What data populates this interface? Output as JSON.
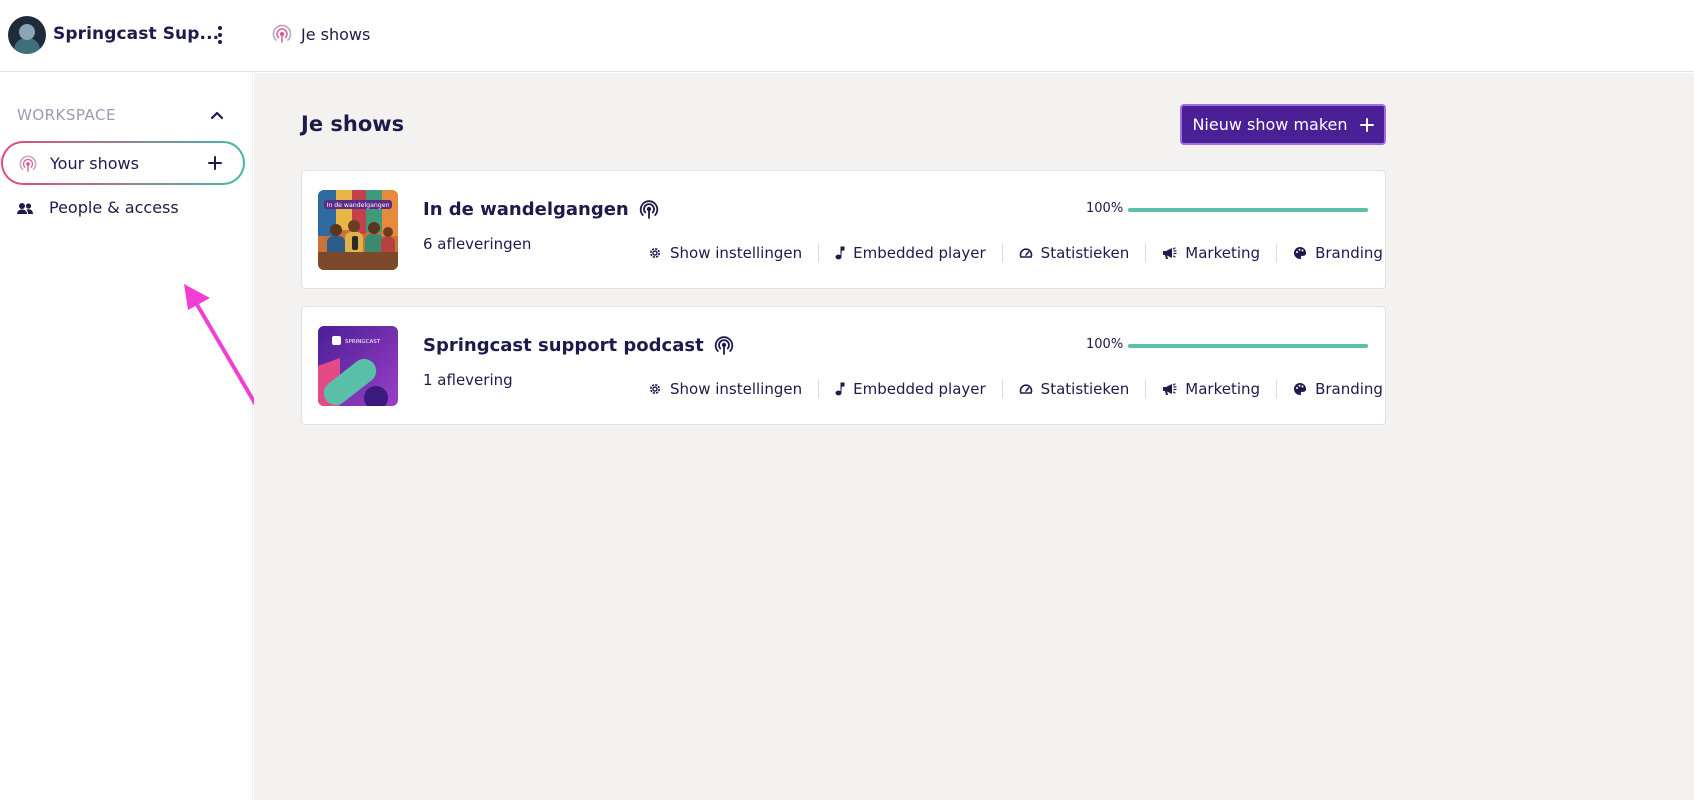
{
  "topbar": {
    "workspace_name": "Springcast Sup...",
    "breadcrumb": "Je shows"
  },
  "sidebar": {
    "section_label": "WORKSPACE",
    "items": [
      {
        "label": "Your shows",
        "icon": "podcast-icon"
      },
      {
        "label": "People & access",
        "icon": "people-icon"
      }
    ]
  },
  "main": {
    "title": "Je shows",
    "new_show_label": "Nieuw show maken",
    "shows": [
      {
        "title": "In de wandelgangen",
        "episodes": "6 afleveringen",
        "progress_label": "100%",
        "progress": 1.0,
        "cover_caption": "In de wandelgangen",
        "actions": [
          "Show instellingen",
          "Embedded player",
          "Statistieken",
          "Marketing",
          "Branding"
        ]
      },
      {
        "title": "Springcast support podcast",
        "episodes": "1 aflevering",
        "progress_label": "100%",
        "progress": 1.0,
        "cover_caption": "SPRINGCAST",
        "actions": [
          "Show instellingen",
          "Embedded player",
          "Statistieken",
          "Marketing",
          "Branding"
        ]
      }
    ]
  },
  "colors": {
    "accent": "#4b1f96",
    "progress": "#5abfa8",
    "annotation_arrow": "#f23fd3"
  }
}
